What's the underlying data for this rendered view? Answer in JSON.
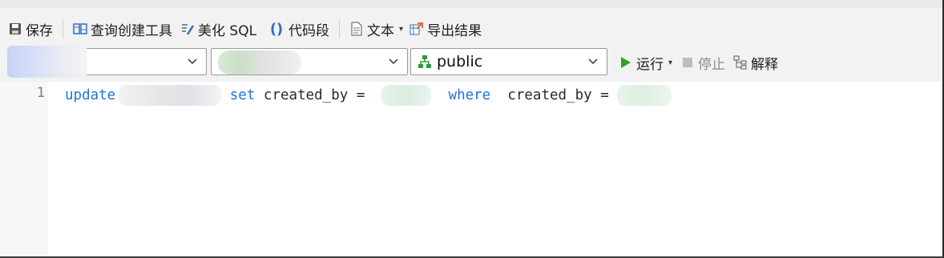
{
  "toolbar": {
    "save": "保存",
    "query_builder": "查询创建工具",
    "beautify_sql": "美化 SQL",
    "snippet": "代码段",
    "text": "文本",
    "export": "导出结果"
  },
  "selectors": {
    "connection": "",
    "database": "",
    "schema": "public"
  },
  "run": {
    "run": "运行",
    "stop": "停止",
    "explain": "解释"
  },
  "editor": {
    "line_number": "1",
    "kw_update": "update",
    "kw_set": "set",
    "col1": "created_by",
    "eq1": "=",
    "kw_where": "where",
    "col2": "created_by",
    "eq2": "="
  },
  "colors": {
    "keyword": "#1f73d6",
    "run_green": "#2aa52a"
  }
}
